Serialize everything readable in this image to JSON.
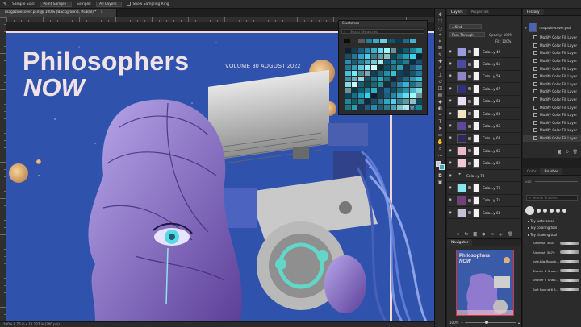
{
  "options_bar": {
    "sample_size_label": "Sample Size:",
    "sample_size_value": "Point Sample",
    "sample_label": "Sample:",
    "sample_value": "All Layers",
    "show_ring_label": "Show Sampling Ring"
  },
  "document": {
    "tab_title": "magazinecover.psd @ 100% (Background, RGB/8) *",
    "close": "×",
    "status": "100%    8.75 in x 11.127 in (300 ppi)"
  },
  "cover": {
    "title": "Philosophers",
    "subtitle": "NOW",
    "volume": "VOLUME 30   AUGUST 2022"
  },
  "swatches_panel": {
    "title": "Swatches",
    "search_placeholder": "Search Swatches",
    "colors": [
      "#12324a",
      "#1a5273",
      "#21708f",
      "#2a8fae",
      "#36a9c4",
      "#57bfd4",
      "#7ed0de",
      "#a7e0e9",
      "#0f4c63",
      "#156b82",
      "#1d8aa0",
      "#2aa8bd"
    ]
  },
  "layers_panel": {
    "tab_layers": "Layers",
    "tab_properties": "Properties",
    "filter_kind": "Kind",
    "blend_mode": "Pass Through",
    "opacity_label": "Opacity:",
    "opacity_value": "100%",
    "fill_label": "Fill:",
    "fill_value": "100%",
    "layers": [
      {
        "name": "Colo...y 49",
        "color": "#9b9be0",
        "type": "layer"
      },
      {
        "name": "Colo...y 61",
        "color": "#4b4aa6",
        "type": "layer"
      },
      {
        "name": "Colo...y 59",
        "color": "#8f84c8",
        "type": "layer"
      },
      {
        "name": "Colo...y 67",
        "color": "#30307a",
        "type": "layer"
      },
      {
        "name": "Colo...y 63",
        "color": "#e6e0f2",
        "type": "layer"
      },
      {
        "name": "Colo...y 60",
        "color": "#efe6c2",
        "type": "layer"
      },
      {
        "name": "Colo...y 66",
        "color": "#5b46a0",
        "type": "layer"
      },
      {
        "name": "Colo...y 64",
        "color": "#2f2a5c",
        "type": "layer"
      },
      {
        "name": "Colo...y 65",
        "color": "#f0b7c9",
        "type": "layer"
      },
      {
        "name": "Colo...y 62",
        "color": "#f3c8d4",
        "type": "layer"
      },
      {
        "name": "Colo...y 78",
        "color": "#1b1b2b",
        "type": "group"
      },
      {
        "name": "Colo...y 76",
        "color": "#8be4f2",
        "type": "layer"
      },
      {
        "name": "Colo...y 71",
        "color": "#7a3a86",
        "type": "layer"
      },
      {
        "name": "Colo...y 68",
        "color": "#c4c0da",
        "type": "layer"
      }
    ]
  },
  "navigator": {
    "title": "Navigator",
    "zoom": "100%",
    "thumb_title": "Philosophers",
    "thumb_sub": "NOW"
  },
  "history_panel": {
    "title": "History",
    "source": "magazinecover.psd",
    "items": [
      "Modify Color Fill Layer",
      "Modify Color Fill Layer",
      "Modify Color Fill Layer",
      "Modify Color Fill Layer",
      "Modify Color Fill Layer",
      "Modify Color Fill Layer",
      "Modify Color Fill Layer",
      "Modify Color Fill Layer",
      "Modify Color Fill Layer",
      "Modify Color Fill Layer",
      "Modify Color Fill Layer",
      "Modify Color Fill Layer",
      "Modify Color Fill Layer",
      "Modify Color Fill Layer"
    ]
  },
  "brushes_panel": {
    "tab_color": "Color",
    "tab_brushes": "Brushes",
    "size_label": "Size:",
    "search_placeholder": "Search Brushes",
    "folders": [
      "Toy watercolor",
      "Toy coloring tool",
      "Toy drawing tool"
    ],
    "brushes": [
      "Airbrush 3845",
      "Airbrush 3879",
      "kyle-Big-Rough...",
      "Shader 4 Shap...",
      "Shader 7 Shap...",
      "Soft Round 6 3..."
    ]
  }
}
